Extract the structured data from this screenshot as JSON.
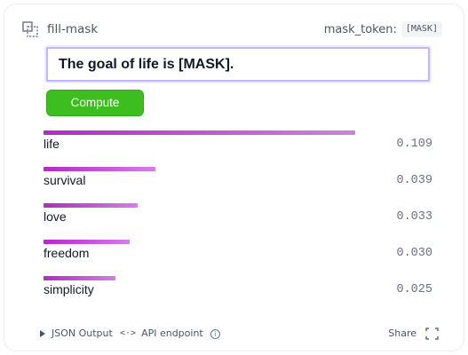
{
  "header": {
    "task": "fill-mask",
    "mask_label": "mask_token:",
    "mask_value": "[MASK]"
  },
  "input": {
    "value": "The goal of life is [MASK]."
  },
  "compute_label": "Compute",
  "results": [
    {
      "label": "life",
      "score": "0.109",
      "fraction": 0.109
    },
    {
      "label": "survival",
      "score": "0.039",
      "fraction": 0.039
    },
    {
      "label": "love",
      "score": "0.033",
      "fraction": 0.033
    },
    {
      "label": "freedom",
      "score": "0.030",
      "fraction": 0.03
    },
    {
      "label": "simplicity",
      "score": "0.025",
      "fraction": 0.025
    }
  ],
  "footer": {
    "json_output": "JSON Output",
    "api_endpoint": "API endpoint",
    "share": "Share"
  },
  "colors": {
    "accent": "#3cbf1e",
    "bar_start": "#b12bc3",
    "bar_end": "#d180e2",
    "input_border": "#c4b5fd"
  },
  "icons": [
    "fill-mask-icon",
    "triangle-right-icon",
    "code-icon",
    "info-icon",
    "fullscreen-icon"
  ]
}
